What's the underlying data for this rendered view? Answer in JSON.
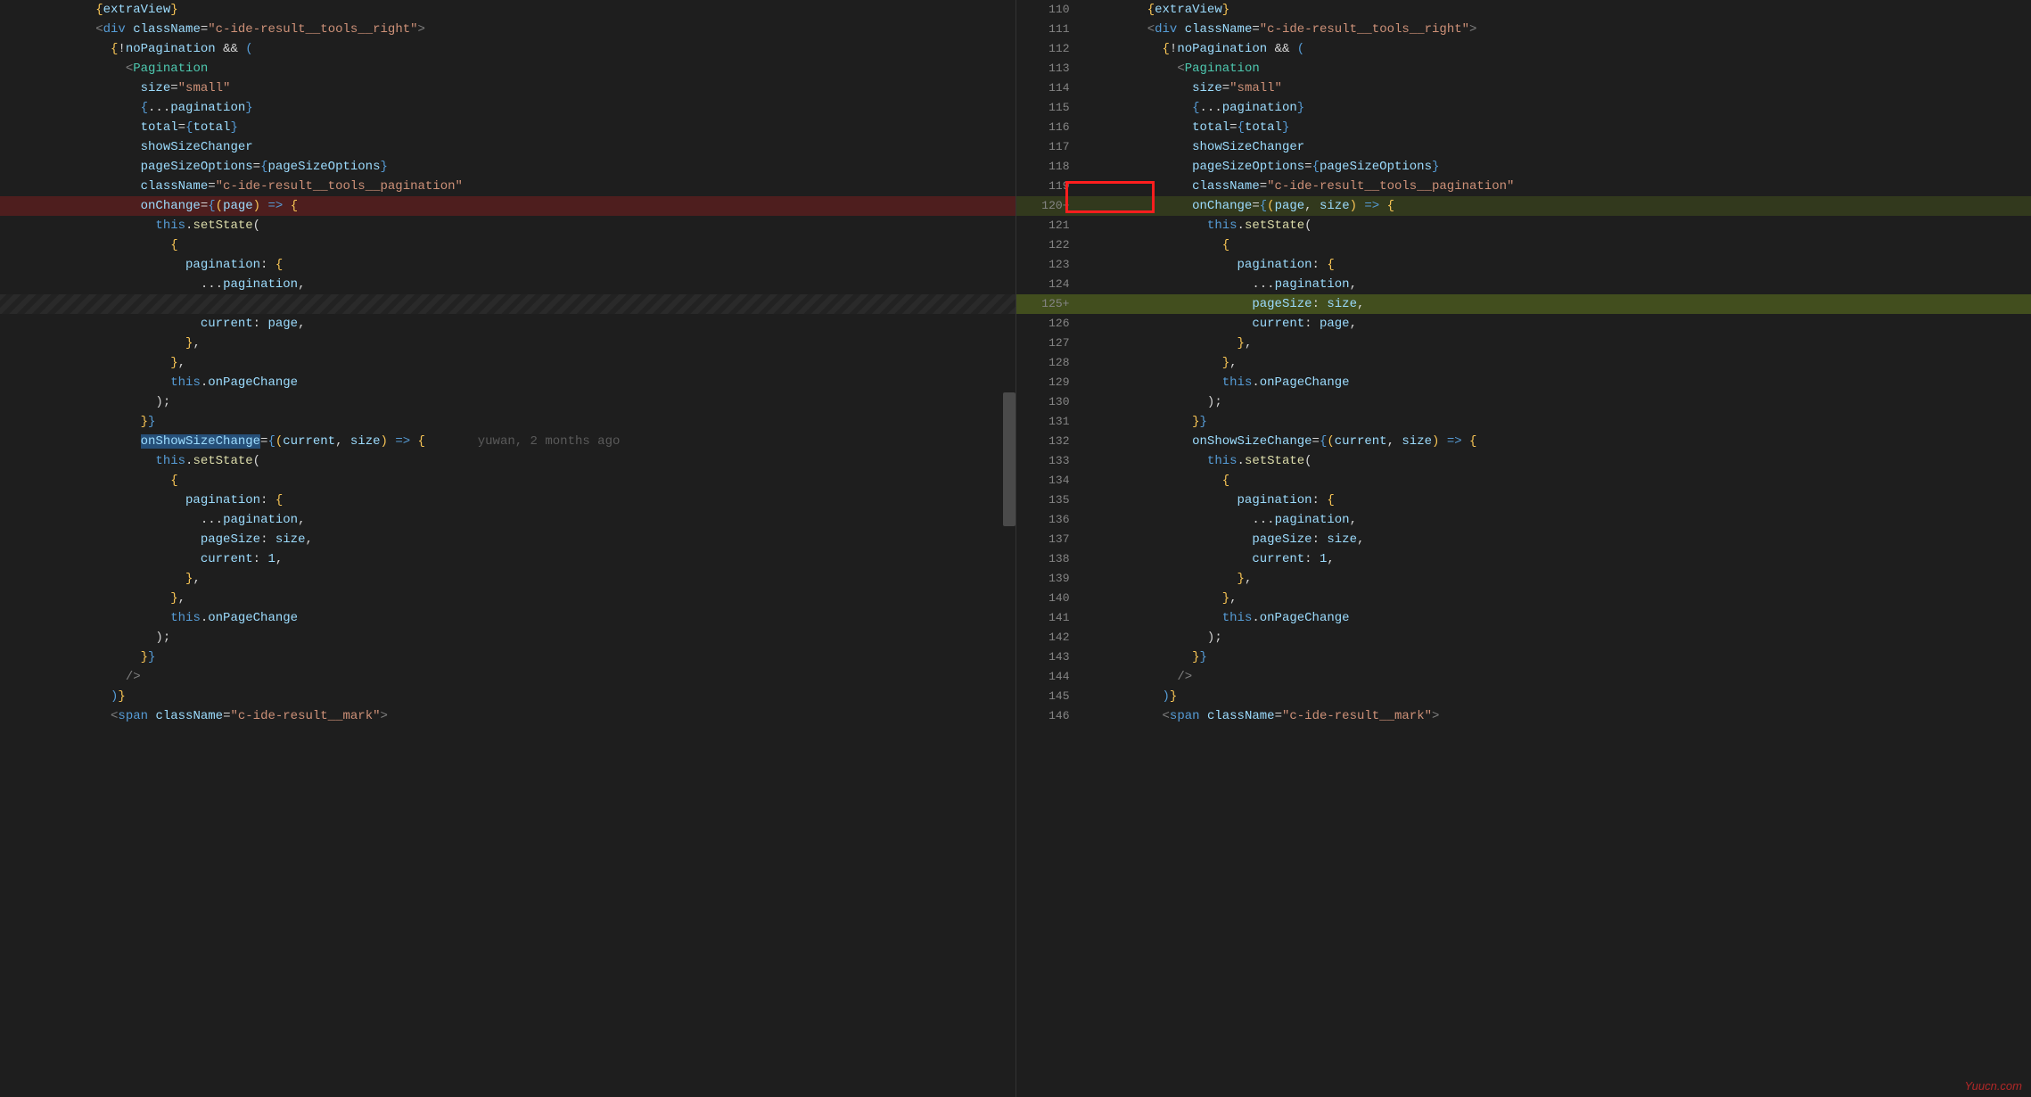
{
  "watermark": "Yuucn.com",
  "blame_left": "yuwan, 2 months ago",
  "right_line_start": 110,
  "left_lines": [
    {
      "type": "normal",
      "html": "        <span class='c-brace'>{</span><span class='c-prop'>extraView</span><span class='c-brace'>}</span>"
    },
    {
      "type": "normal",
      "html": "        <span class='c-tag'>&lt;</span><span class='c-elname'>div</span> <span class='c-attr'>className</span><span class='c-punc'>=</span><span class='c-string'>\"c-ide-result__tools__right\"</span><span class='c-tag'>&gt;</span>"
    },
    {
      "type": "normal",
      "html": "          <span class='c-brace'>{</span><span class='c-punc'>!</span><span class='c-prop'>noPagination</span> <span class='c-punc'>&amp;&amp;</span> <span class='c-brace-blue'>(</span>"
    },
    {
      "type": "normal",
      "html": "            <span class='c-tag'>&lt;</span><span class='c-component'>Pagination</span>"
    },
    {
      "type": "normal",
      "html": "              <span class='c-attr'>size</span><span class='c-punc'>=</span><span class='c-string'>\"small\"</span>"
    },
    {
      "type": "normal",
      "html": "              <span class='c-brace-blue'>{</span><span class='c-punc'>...</span><span class='c-prop'>pagination</span><span class='c-brace-blue'>}</span>"
    },
    {
      "type": "normal",
      "html": "              <span class='c-attr'>total</span><span class='c-punc'>=</span><span class='c-brace-blue'>{</span><span class='c-prop'>total</span><span class='c-brace-blue'>}</span>"
    },
    {
      "type": "normal",
      "html": "              <span class='c-attr'>showSizeChanger</span>"
    },
    {
      "type": "normal",
      "html": "              <span class='c-attr'>pageSizeOptions</span><span class='c-punc'>=</span><span class='c-brace-blue'>{</span><span class='c-prop'>pageSizeOptions</span><span class='c-brace-blue'>}</span>"
    },
    {
      "type": "normal",
      "html": "              <span class='c-attr'>className</span><span class='c-punc'>=</span><span class='c-string'>\"c-ide-result__tools__pagination\"</span>"
    },
    {
      "type": "removed",
      "html": "              <span class='c-attr'>onChange</span><span class='c-punc'>=</span><span class='c-brace-blue'>{</span><span class='c-brace'>(</span><span class='c-param'>page</span><span class='c-brace'>)</span> <span class='c-arrow'>=&gt;</span> <span class='c-brace'>{</span>"
    },
    {
      "type": "normal",
      "html": "                <span class='c-this'>this</span><span class='c-punc'>.</span><span class='c-method'>setState</span><span class='c-punc'>(</span>"
    },
    {
      "type": "normal",
      "html": "                  <span class='c-brace'>{</span>"
    },
    {
      "type": "normal",
      "html": "                    <span class='c-key'>pagination</span><span class='c-punc'>:</span> <span class='c-brace'>{</span>"
    },
    {
      "type": "normal",
      "html": "                      <span class='c-punc'>...</span><span class='c-prop'>pagination</span><span class='c-punc'>,</span>"
    },
    {
      "type": "hatched",
      "html": ""
    },
    {
      "type": "normal",
      "html": "                      <span class='c-key'>current</span><span class='c-punc'>:</span> <span class='c-prop'>page</span><span class='c-punc'>,</span>"
    },
    {
      "type": "normal",
      "html": "                    <span class='c-brace'>}</span><span class='c-punc'>,</span>"
    },
    {
      "type": "normal",
      "html": "                  <span class='c-brace'>}</span><span class='c-punc'>,</span>"
    },
    {
      "type": "normal",
      "html": "                  <span class='c-this'>this</span><span class='c-punc'>.</span><span class='c-prop'>onPageChange</span>"
    },
    {
      "type": "normal",
      "html": "                <span class='c-punc'>);</span>"
    },
    {
      "type": "normal",
      "html": "              <span class='c-brace'>}</span><span class='c-brace-blue'>}</span>"
    },
    {
      "type": "blame",
      "html": "              <span class='selection'><span class='c-attr'>onShowSizeChange</span></span><span class='c-punc'>=</span><span class='c-brace-blue'>{</span><span class='c-brace'>(</span><span class='c-param'>current</span><span class='c-punc'>,</span> <span class='c-param'>size</span><span class='c-brace'>)</span> <span class='c-arrow'>=&gt;</span> <span class='c-brace'>{</span>"
    },
    {
      "type": "normal",
      "html": "                <span class='c-this'>this</span><span class='c-punc'>.</span><span class='c-method'>setState</span><span class='c-punc'>(</span>"
    },
    {
      "type": "normal",
      "html": "                  <span class='c-brace'>{</span>"
    },
    {
      "type": "normal",
      "html": "                    <span class='c-key'>pagination</span><span class='c-punc'>:</span> <span class='c-brace'>{</span>"
    },
    {
      "type": "normal",
      "html": "                      <span class='c-punc'>...</span><span class='c-prop'>pagination</span><span class='c-punc'>,</span>"
    },
    {
      "type": "normal",
      "html": "                      <span class='c-key'>pageSize</span><span class='c-punc'>:</span> <span class='c-prop'>size</span><span class='c-punc'>,</span>"
    },
    {
      "type": "normal",
      "html": "                      <span class='c-key'>current</span><span class='c-punc'>:</span> <span class='c-prop'>1</span><span class='c-punc'>,</span>"
    },
    {
      "type": "normal",
      "html": "                    <span class='c-brace'>}</span><span class='c-punc'>,</span>"
    },
    {
      "type": "normal",
      "html": "                  <span class='c-brace'>}</span><span class='c-punc'>,</span>"
    },
    {
      "type": "normal",
      "html": "                  <span class='c-this'>this</span><span class='c-punc'>.</span><span class='c-prop'>onPageChange</span>"
    },
    {
      "type": "normal",
      "html": "                <span class='c-punc'>);</span>"
    },
    {
      "type": "normal",
      "html": "              <span class='c-brace'>}</span><span class='c-brace-blue'>}</span>"
    },
    {
      "type": "normal",
      "html": "            <span class='c-tag'>/&gt;</span>"
    },
    {
      "type": "normal",
      "html": "          <span class='c-brace-blue'>)</span><span class='c-brace'>}</span>"
    },
    {
      "type": "normal",
      "html": "          <span class='c-tag'>&lt;</span><span class='c-elname'>span</span> <span class='c-attr'>className</span><span class='c-punc'>=</span><span class='c-string'>\"c-ide-result__mark\"</span><span class='c-tag'>&gt;</span>"
    }
  ],
  "right_lines": [
    {
      "num": "110",
      "type": "normal",
      "html": "        <span class='c-brace'>{</span><span class='c-prop'>extraView</span><span class='c-brace'>}</span>"
    },
    {
      "num": "111",
      "type": "normal",
      "html": "        <span class='c-tag'>&lt;</span><span class='c-elname'>div</span> <span class='c-attr'>className</span><span class='c-punc'>=</span><span class='c-string'>\"c-ide-result__tools__right\"</span><span class='c-tag'>&gt;</span>"
    },
    {
      "num": "112",
      "type": "normal",
      "html": "          <span class='c-brace'>{</span><span class='c-punc'>!</span><span class='c-prop'>noPagination</span> <span class='c-punc'>&amp;&amp;</span> <span class='c-brace-blue'>(</span>"
    },
    {
      "num": "113",
      "type": "normal",
      "html": "            <span class='c-tag'>&lt;</span><span class='c-component'>Pagination</span>"
    },
    {
      "num": "114",
      "type": "normal",
      "html": "              <span class='c-attr'>size</span><span class='c-punc'>=</span><span class='c-string'>\"small\"</span>"
    },
    {
      "num": "115",
      "type": "normal",
      "html": "              <span class='c-brace-blue'>{</span><span class='c-punc'>...</span><span class='c-prop'>pagination</span><span class='c-brace-blue'>}</span>"
    },
    {
      "num": "116",
      "type": "normal",
      "html": "              <span class='c-attr'>total</span><span class='c-punc'>=</span><span class='c-brace-blue'>{</span><span class='c-prop'>total</span><span class='c-brace-blue'>}</span>"
    },
    {
      "num": "117",
      "type": "normal",
      "html": "              <span class='c-attr'>showSizeChanger</span>"
    },
    {
      "num": "118",
      "type": "normal",
      "html": "              <span class='c-attr'>pageSizeOptions</span><span class='c-punc'>=</span><span class='c-brace-blue'>{</span><span class='c-prop'>pageSizeOptions</span><span class='c-brace-blue'>}</span>"
    },
    {
      "num": "119",
      "type": "normal",
      "html": "              <span class='c-attr'>className</span><span class='c-punc'>=</span><span class='c-string'>\"c-ide-result__tools__pagination\"</span>"
    },
    {
      "num": "120+",
      "type": "added",
      "html": "              <span class='c-attr'>onChange</span><span class='c-punc'>=</span><span class='c-brace-blue'>{</span><span class='c-brace'>(</span><span class='c-param'>page</span><span class='c-punc'>,</span> <span class='c-param'>size</span><span class='c-brace'>)</span> <span class='c-arrow'>=&gt;</span> <span class='c-brace'>{</span>"
    },
    {
      "num": "121",
      "type": "normal",
      "html": "                <span class='c-this'>this</span><span class='c-punc'>.</span><span class='c-method'>setState</span><span class='c-punc'>(</span>"
    },
    {
      "num": "122",
      "type": "normal",
      "html": "                  <span class='c-brace'>{</span>"
    },
    {
      "num": "123",
      "type": "normal",
      "html": "                    <span class='c-key'>pagination</span><span class='c-punc'>:</span> <span class='c-brace'>{</span>"
    },
    {
      "num": "124",
      "type": "normal",
      "html": "                      <span class='c-punc'>...</span><span class='c-prop'>pagination</span><span class='c-punc'>,</span>"
    },
    {
      "num": "125+",
      "type": "added-strong",
      "html": "                      <span class='c-key'>pageSize</span><span class='c-punc'>:</span> <span class='c-prop'>size</span><span class='c-punc'>,</span>"
    },
    {
      "num": "126",
      "type": "normal",
      "html": "                      <span class='c-key'>current</span><span class='c-punc'>:</span> <span class='c-prop'>page</span><span class='c-punc'>,</span>"
    },
    {
      "num": "127",
      "type": "normal",
      "html": "                    <span class='c-brace'>}</span><span class='c-punc'>,</span>"
    },
    {
      "num": "128",
      "type": "normal",
      "html": "                  <span class='c-brace'>}</span><span class='c-punc'>,</span>"
    },
    {
      "num": "129",
      "type": "normal",
      "html": "                  <span class='c-this'>this</span><span class='c-punc'>.</span><span class='c-prop'>onPageChange</span>"
    },
    {
      "num": "130",
      "type": "normal",
      "html": "                <span class='c-punc'>);</span>"
    },
    {
      "num": "131",
      "type": "normal",
      "html": "              <span class='c-brace'>}</span><span class='c-brace-blue'>}</span>"
    },
    {
      "num": "132",
      "type": "normal",
      "html": "              <span class='c-attr'>onShowSizeChange</span><span class='c-punc'>=</span><span class='c-brace-blue'>{</span><span class='c-brace'>(</span><span class='c-param'>current</span><span class='c-punc'>,</span> <span class='c-param'>size</span><span class='c-brace'>)</span> <span class='c-arrow'>=&gt;</span> <span class='c-brace'>{</span>"
    },
    {
      "num": "133",
      "type": "normal",
      "html": "                <span class='c-this'>this</span><span class='c-punc'>.</span><span class='c-method'>setState</span><span class='c-punc'>(</span>"
    },
    {
      "num": "134",
      "type": "normal",
      "html": "                  <span class='c-brace'>{</span>"
    },
    {
      "num": "135",
      "type": "normal",
      "html": "                    <span class='c-key'>pagination</span><span class='c-punc'>:</span> <span class='c-brace'>{</span>"
    },
    {
      "num": "136",
      "type": "normal",
      "html": "                      <span class='c-punc'>...</span><span class='c-prop'>pagination</span><span class='c-punc'>,</span>"
    },
    {
      "num": "137",
      "type": "normal",
      "html": "                      <span class='c-key'>pageSize</span><span class='c-punc'>:</span> <span class='c-prop'>size</span><span class='c-punc'>,</span>"
    },
    {
      "num": "138",
      "type": "normal",
      "html": "                      <span class='c-key'>current</span><span class='c-punc'>:</span> <span class='c-prop'>1</span><span class='c-punc'>,</span>"
    },
    {
      "num": "139",
      "type": "normal",
      "html": "                    <span class='c-brace'>}</span><span class='c-punc'>,</span>"
    },
    {
      "num": "140",
      "type": "normal",
      "html": "                  <span class='c-brace'>}</span><span class='c-punc'>,</span>"
    },
    {
      "num": "141",
      "type": "normal",
      "html": "                  <span class='c-this'>this</span><span class='c-punc'>.</span><span class='c-prop'>onPageChange</span>"
    },
    {
      "num": "142",
      "type": "normal",
      "html": "                <span class='c-punc'>);</span>"
    },
    {
      "num": "143",
      "type": "normal",
      "html": "              <span class='c-brace'>}</span><span class='c-brace-blue'>}</span>"
    },
    {
      "num": "144",
      "type": "normal",
      "html": "            <span class='c-tag'>/&gt;</span>"
    },
    {
      "num": "145",
      "type": "normal",
      "html": "          <span class='c-brace-blue'>)</span><span class='c-brace'>}</span>"
    },
    {
      "num": "146",
      "type": "normal",
      "html": "          <span class='c-tag'>&lt;</span><span class='c-elname'>span</span> <span class='c-attr'>className</span><span class='c-punc'>=</span><span class='c-string'>\"c-ide-result__mark\"</span><span class='c-tag'>&gt;</span>"
    }
  ]
}
